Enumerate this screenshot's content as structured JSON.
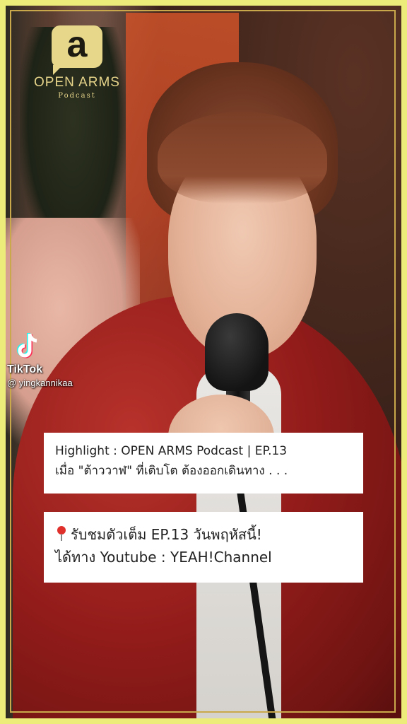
{
  "logo": {
    "mark": "a",
    "title": "OPEN ARMS",
    "subtitle": "Podcast"
  },
  "watermark": {
    "app_name": "TikTok",
    "username": "@ yingkannikaa"
  },
  "caption1": {
    "line1": "Highlight : OPEN ARMS Podcast | EP.13",
    "line2": "เมื่อ \"ต้าววาฬ\" ที่เติบโต ต้องออกเดินทาง . . ."
  },
  "caption2": {
    "line1": "รับชมตัวเต็ม EP.13 วันพฤหัสนี้!",
    "line2": "ได้ทาง Youtube : YEAH!Channel"
  },
  "colors": {
    "frame_background": "#ecec7a",
    "frame_line": "#c8a84a",
    "logo": "#e6d48a",
    "caption_background": "#ffffff",
    "pin": "#e0302c"
  },
  "icons": {
    "tiktok": "tiktok-logo-icon",
    "pin": "red-pushpin-icon"
  }
}
